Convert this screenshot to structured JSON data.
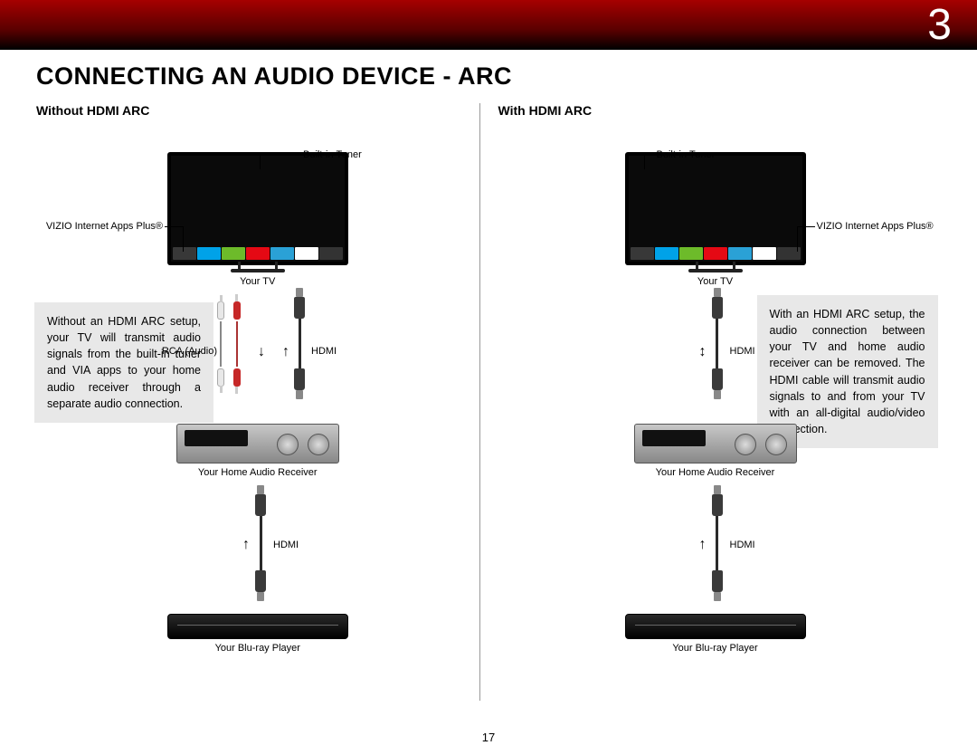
{
  "chapter_number": "3",
  "page_title": "CONNECTING AN AUDIO DEVICE - ARC",
  "page_number": "17",
  "left": {
    "subheading": "Without HDMI ARC",
    "tuner_label": "Built-in Tuner",
    "apps_label": "VIZIO Internet Apps Plus®",
    "tv_caption": "Your TV",
    "rca_label": "RCA (Audio)",
    "hdmi_label_top": "HDMI",
    "receiver_caption": "Your Home Audio Receiver",
    "hdmi_label_bottom": "HDMI",
    "bluray_caption": "Your Blu-ray Player",
    "description": "Without an HDMI ARC setup, your TV will transmit audio signals from the built-in tuner and VIA apps to your home audio receiver through a separate audio connection."
  },
  "right": {
    "subheading": "With HDMI ARC",
    "tuner_label": "Built-in Tuner",
    "apps_label": "VIZIO Internet Apps Plus®",
    "tv_caption": "Your TV",
    "hdmi_label_top": "HDMI",
    "receiver_caption": "Your Home Audio Receiver",
    "hdmi_label_bottom": "HDMI",
    "bluray_caption": "Your Blu-ray Player",
    "description": "With an HDMI ARC setup, the audio connection between your TV and home audio receiver can be removed. The HDMI cable will transmit audio signals to and from your TV with an all-digital audio/video connection."
  }
}
